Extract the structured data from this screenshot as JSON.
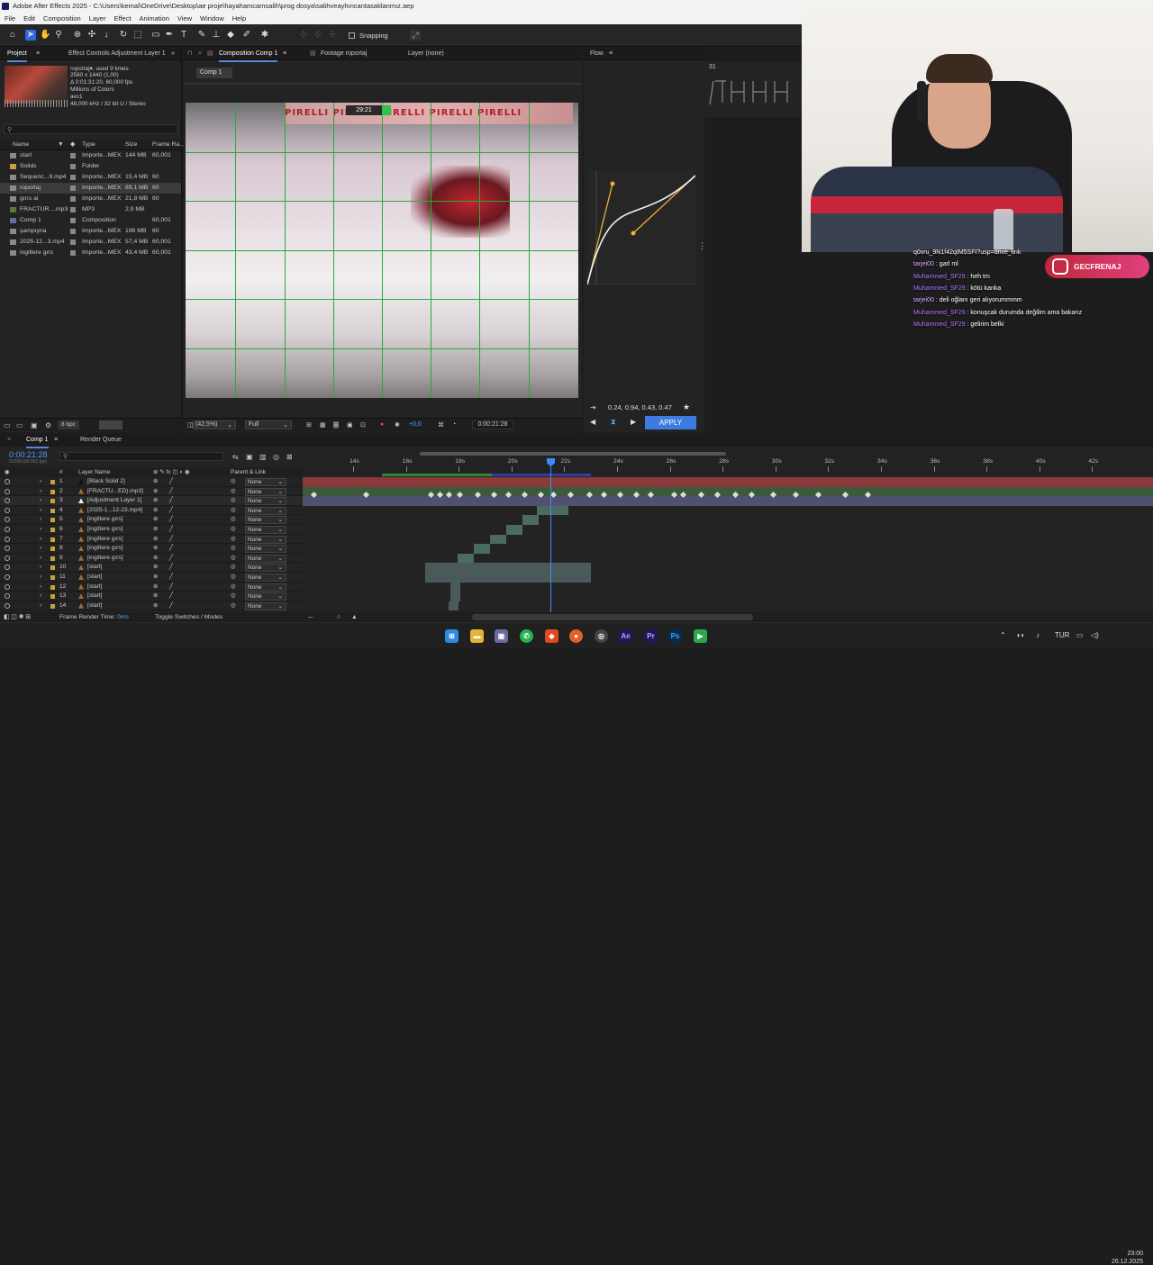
{
  "window": {
    "title": "Adobe After Effects 2025 - C:\\Users\\kemal\\OneDrive\\Desktop\\ae proje\\hayahamcamsalih\\prog dosya\\salihveayhıncantasaklanmız.aep"
  },
  "menu": [
    "File",
    "Edit",
    "Composition",
    "Layer",
    "Effect",
    "Animation",
    "View",
    "Window",
    "Help"
  ],
  "toolbar": {
    "snapping_label": "Snapping"
  },
  "project_panel": {
    "tabs": [
      "Project",
      "Effect Controls Adjustment Layer 1"
    ],
    "selected_item": {
      "name": "roportaj▾",
      "used": ", used 9 times",
      "res": "2560 x 1440 (1,00)",
      "duration": "Δ 0:01:31:20, 60,000 fps",
      "colors": "Millions of Colors",
      "codec": "avc1",
      "audio": "48,000 kHz / 32 bit U / Stereo"
    },
    "columns": {
      "name": "Name",
      "type": "Type",
      "size": "Size",
      "frame_rate": "Frame Ra..."
    },
    "items": [
      {
        "name": "start",
        "type": "Importe...MEX",
        "size": "144 MB",
        "fps": "60,001",
        "kind": "video"
      },
      {
        "name": "Solids",
        "type": "Folder",
        "size": "",
        "fps": "",
        "kind": "folder"
      },
      {
        "name": "Sequenc...9.mp4",
        "type": "Importe...MEX",
        "size": "15,4 MB",
        "fps": "60",
        "kind": "video"
      },
      {
        "name": "roportaj",
        "type": "Importe...MEX",
        "size": "89,1 MB",
        "fps": "60",
        "kind": "video",
        "selected": true
      },
      {
        "name": "gırıs ai",
        "type": "Importe...MEX",
        "size": "21,8 MB",
        "fps": "60",
        "kind": "video"
      },
      {
        "name": "FRACTUR....mp3",
        "type": "MP3",
        "size": "2,9 MB",
        "fps": "",
        "kind": "audio"
      },
      {
        "name": "Comp 1",
        "type": "Composition",
        "size": "",
        "fps": "60,001",
        "kind": "comp"
      },
      {
        "name": "şampıyna",
        "type": "Importe...MEX",
        "size": "196 MB",
        "fps": "60",
        "kind": "video"
      },
      {
        "name": "2025-12...3.mp4",
        "type": "Importe...MEX",
        "size": "57,4 MB",
        "fps": "60,001",
        "kind": "video"
      },
      {
        "name": "ingiltere gırs",
        "type": "Importe...MEX",
        "size": "43,4 MB",
        "fps": "60,001",
        "kind": "video"
      }
    ],
    "bpc": "8 bpc"
  },
  "composition_panel": {
    "tabs": [
      "Composition Comp 1",
      "Footage roportaj",
      "Layer (none)"
    ],
    "chip": "Comp 1",
    "viewer_time": "29:21",
    "banner_text": "PIRELLI    PIRELLI    PIRELLI    PIRELLI    PIRELLI",
    "zoom": "(42,5%)",
    "resolution": "Full",
    "exposure": "+0,0",
    "timecode": "0:00:21:28"
  },
  "flow_panel": {
    "title": "Flow",
    "values": "0.24, 0.94, 0.43, 0.47",
    "apply_label": "APPLY",
    "gallery_number": "31"
  },
  "chat": [
    {
      "user": "",
      "text": "q0vru_9N1f42qIM5SFI?usp=drive_link"
    },
    {
      "user": "tarjei00",
      "text": " : garl ml"
    },
    {
      "user": "Muhammed_SF29",
      "text": " : heh tm"
    },
    {
      "user": "Muhammed_SF29",
      "text": " : kötü kanka"
    },
    {
      "user": "tarjei00",
      "text": " : deli oğlanı geri alıyorummmm"
    },
    {
      "user": "Muhammed_SF29",
      "text": " : konuşcak durumda değilim ama bakarız"
    },
    {
      "user": "Muhammed_SF29",
      "text": " : gelirim belki"
    }
  ],
  "instagram_handle": "GECFRENAJ",
  "timeline": {
    "tabs": [
      "Comp 1",
      "Render Queue"
    ],
    "timecode": "0:00:21:28",
    "timecode_sub": "01289 (60.001 fps)",
    "headers": {
      "layer_name": "Layer Name",
      "parent": "Parent & Link"
    },
    "ruler_labels": [
      "14s",
      "16s",
      "18s",
      "20s",
      "22s",
      "24s",
      "26s",
      "28s",
      "30s",
      "32s",
      "34s",
      "36s",
      "38s",
      "40s",
      "42s"
    ],
    "layers": [
      {
        "num": "1",
        "name": "[Black Solid 2]",
        "parent": "None"
      },
      {
        "num": "2",
        "name": "[FRACTU...ED).mp3]",
        "parent": "None"
      },
      {
        "num": "3",
        "name": "[Adjustment Layer 1]",
        "parent": "None"
      },
      {
        "num": "4",
        "name": "[2025-1...12-23.mp4]",
        "parent": "None"
      },
      {
        "num": "5",
        "name": "[ingiltere gırs]",
        "parent": "None"
      },
      {
        "num": "6",
        "name": "[ingiltere gırs]",
        "parent": "None"
      },
      {
        "num": "7",
        "name": "[ingiltere gırs]",
        "parent": "None"
      },
      {
        "num": "8",
        "name": "[ingiltere gırs]",
        "parent": "None"
      },
      {
        "num": "9",
        "name": "[ingiltere gırs]",
        "parent": "None"
      },
      {
        "num": "10",
        "name": "[start]",
        "parent": "None"
      },
      {
        "num": "11",
        "name": "[start]",
        "parent": "None"
      },
      {
        "num": "12",
        "name": "[start]",
        "parent": "None"
      },
      {
        "num": "13",
        "name": "[start]",
        "parent": "None"
      },
      {
        "num": "14",
        "name": "[start]",
        "parent": "None"
      }
    ],
    "footer": {
      "render_time_label": "Frame Render Time:",
      "render_time": "0ms",
      "toggle": "Toggle Switches / Modes"
    }
  },
  "taskbar": {
    "lang": "TUR",
    "time": "23:00",
    "date": "26.12.2025"
  }
}
